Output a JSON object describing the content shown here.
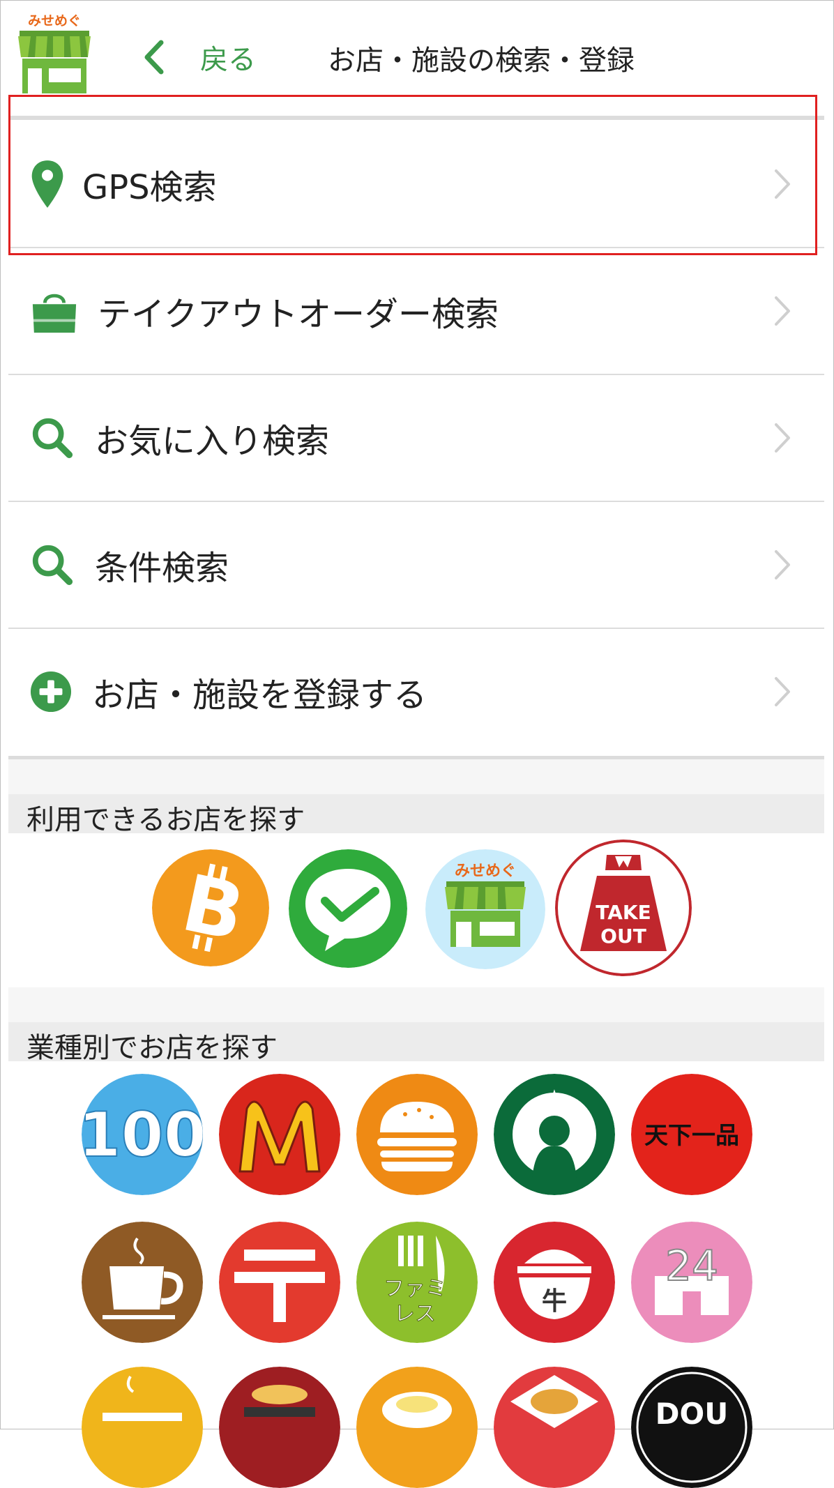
{
  "app": {
    "logo_text": "みせめぐ"
  },
  "header": {
    "back_label": "戻る",
    "title": "お店・施設の検索・登録"
  },
  "menu": [
    {
      "label": "GPS検索",
      "icon": "map-pin-icon"
    },
    {
      "label": "テイクアウトオーダー検索",
      "icon": "shopping-bag-icon"
    },
    {
      "label": "お気に入り検索",
      "icon": "search-icon"
    },
    {
      "label": "条件検索",
      "icon": "search-icon"
    },
    {
      "label": "お店・施設を登録する",
      "icon": "plus-circle-icon"
    }
  ],
  "sections": {
    "payment": {
      "title": "利用できるお店を探す",
      "items": [
        {
          "name": "bitcoin",
          "icon": "bitcoin-icon"
        },
        {
          "name": "wechat",
          "icon": "wechat-pay-icon"
        },
        {
          "name": "misemegu",
          "icon": "misemegu-store-icon",
          "text": "みせめぐ"
        },
        {
          "name": "takeout",
          "icon": "takeout-bag-icon",
          "text": "TAKE OUT"
        }
      ]
    },
    "category": {
      "title": "業種別でお店を探す",
      "items": [
        {
          "name": "100yen",
          "text": "100"
        },
        {
          "name": "mcdonalds",
          "text": "M"
        },
        {
          "name": "burger",
          "text": ""
        },
        {
          "name": "starbucks",
          "text": "★"
        },
        {
          "name": "tenkaippin",
          "text": "天下一品"
        },
        {
          "name": "cafe",
          "text": ""
        },
        {
          "name": "post-office",
          "text": "〒"
        },
        {
          "name": "family-restaurant",
          "text": "ファミレス"
        },
        {
          "name": "gyudon",
          "text": "牛"
        },
        {
          "name": "convenience-24",
          "text": "24"
        },
        {
          "name": "ramen",
          "text": ""
        },
        {
          "name": "tempura",
          "text": ""
        },
        {
          "name": "omurice",
          "text": ""
        },
        {
          "name": "curry",
          "text": ""
        },
        {
          "name": "doutor",
          "text": "DOU"
        }
      ]
    }
  },
  "colors": {
    "brand_green": "#3c9a4b",
    "highlight_red": "#e02020",
    "orange": "#e8681a"
  }
}
